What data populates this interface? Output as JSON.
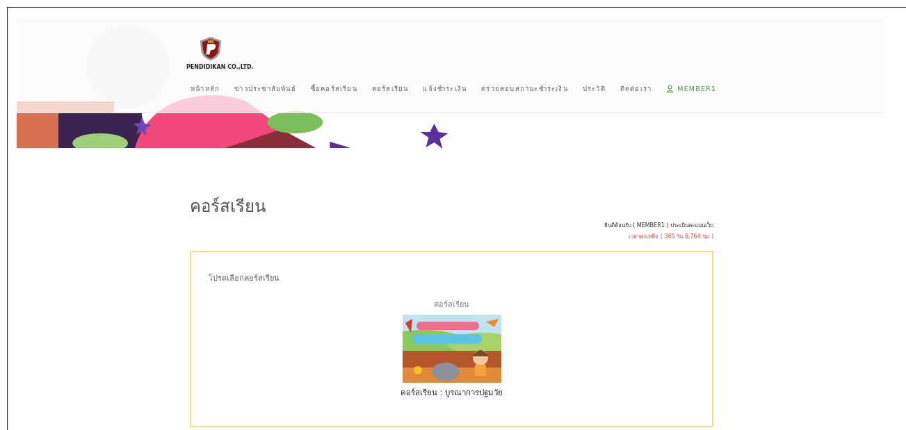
{
  "header": {
    "logo_text": "PENDIDIKAN CO.,LTD.",
    "nav": [
      {
        "label": "หน้าหลัก",
        "kind": "link"
      },
      {
        "label": "ข่าวประชาสัมพันธ์",
        "kind": "link"
      },
      {
        "label": "ซื้อคอร์สเรียน",
        "kind": "link"
      },
      {
        "label": "คอร์สเรียน",
        "kind": "link"
      },
      {
        "label": "แจ้งชำระเงิน",
        "kind": "link"
      },
      {
        "label": "ตรวจสอบสถานะชำระเงิน",
        "kind": "link"
      },
      {
        "label": "ประวัติ",
        "kind": "link"
      },
      {
        "label": "ติดต่อเรา",
        "kind": "link"
      },
      {
        "label": "MEMBER1",
        "kind": "user"
      }
    ]
  },
  "page_title": "คอร์สเรียน",
  "welcome": "ยินดีต้อนรับ ( MEMBER1 ) ประเมินคะแนนเว็บ",
  "time_left": "เวลาคงเหลือ ( 365 วัน 8,764 ชม )",
  "panel": {
    "prompt": "โปรดเลือกคอร์สเรียน",
    "courses": [
      {
        "heading": "คอร์สเรียน",
        "caption": "คอร์สเรียน : บูรณาการปฐมวัย"
      }
    ]
  }
}
